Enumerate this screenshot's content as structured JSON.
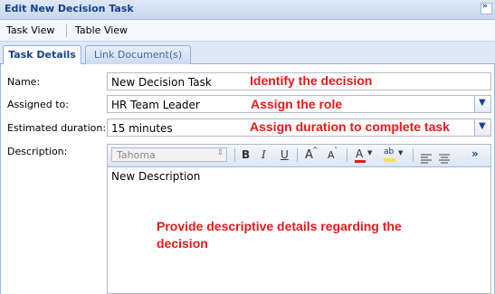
{
  "window": {
    "title": "Edit New Decision Task",
    "collapse_glyph": "»"
  },
  "menu": {
    "items": [
      "Task View",
      "Table View"
    ]
  },
  "tabs": [
    {
      "label": "Task Details",
      "active": true
    },
    {
      "label": "Link Document(s)",
      "active": false
    }
  ],
  "form": {
    "name_label": "Name:",
    "name_value": "New Decision Task",
    "assigned_label": "Assigned to:",
    "assigned_value": "HR Team Leader",
    "duration_label": "Estimated duration:",
    "duration_value": "15 minutes",
    "description_label": "Description:",
    "description_value": "New Description"
  },
  "editor_toolbar": {
    "font": "Tahoma",
    "bold": "B",
    "italic": "I",
    "underline": "U",
    "grow": "A",
    "shrink": "A",
    "color": "A",
    "highlight": "ab",
    "more": "»"
  },
  "annotations": {
    "name": "Identify the decision",
    "assigned": "Assign the role",
    "duration": "Assign duration to complete task",
    "description_line1": "Provide descriptive details regarding the",
    "description_line2": "decision"
  },
  "colors": {
    "annotation": "#e8181a",
    "header_text": "#15428b"
  }
}
